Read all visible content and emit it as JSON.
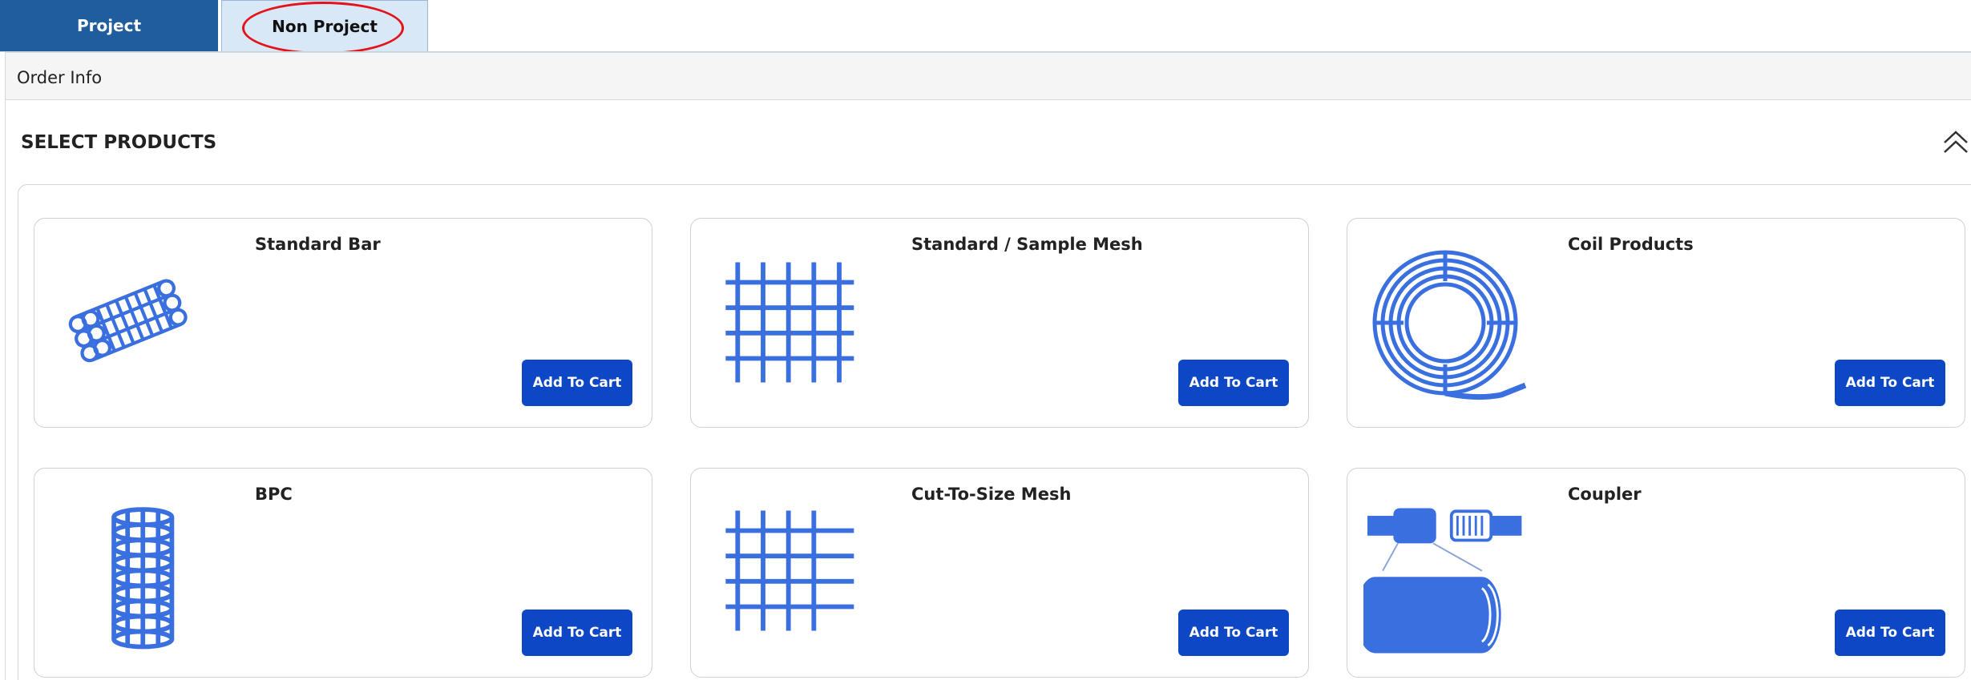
{
  "tabs": [
    {
      "label": "Project",
      "active": true
    },
    {
      "label": "Non Project",
      "active": false
    }
  ],
  "order_info": {
    "label": "Order Info"
  },
  "section": {
    "title": "SELECT PRODUCTS",
    "collapse_icon": "chevron-double-up-icon"
  },
  "products": [
    {
      "title": "Standard Bar",
      "icon": "rebar-bundle-icon",
      "button": "Add To Cart"
    },
    {
      "title": "Standard / Sample Mesh",
      "icon": "mesh-grid-icon",
      "button": "Add To Cart"
    },
    {
      "title": "Coil Products",
      "icon": "coil-icon",
      "button": "Add To Cart"
    },
    {
      "title": "BPC",
      "icon": "cage-icon",
      "button": "Add To Cart"
    },
    {
      "title": "Cut-To-Size Mesh",
      "icon": "cut-mesh-icon",
      "button": "Add To Cart"
    },
    {
      "title": "Coupler",
      "icon": "coupler-icon",
      "button": "Add To Cart"
    }
  ],
  "colors": {
    "accent": "#3a6fe0",
    "button": "#0d47c6",
    "tab_active": "#1f5d9e",
    "highlight": "#e3131b"
  }
}
